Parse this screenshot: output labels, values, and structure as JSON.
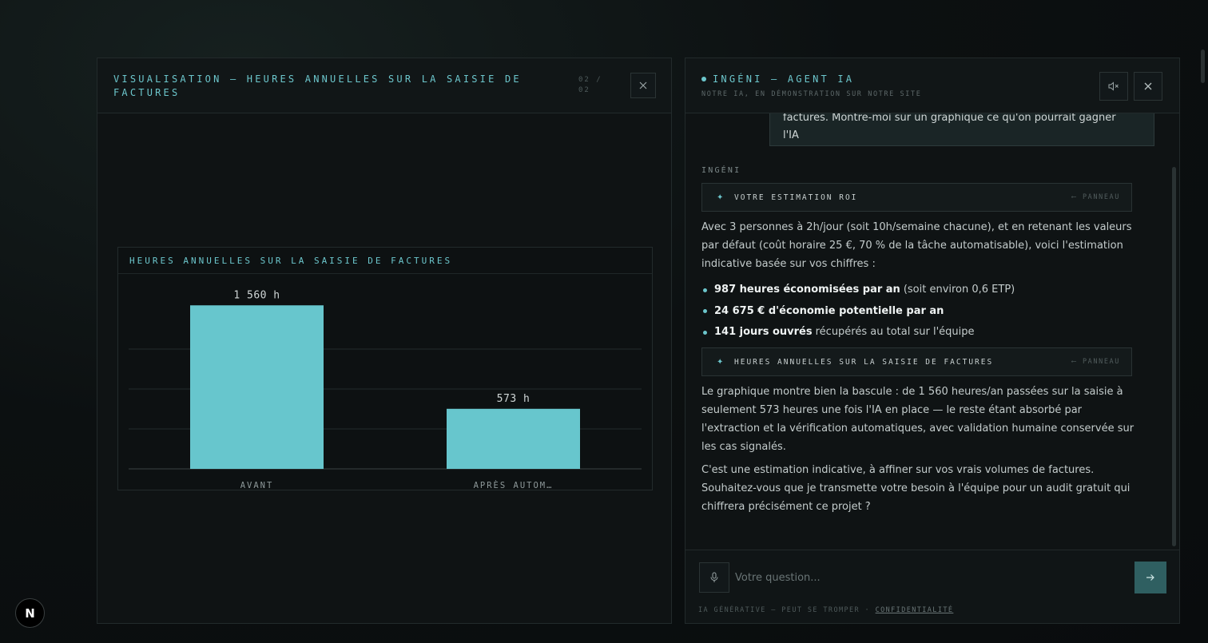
{
  "viz_panel": {
    "title": "VISUALISATION — HEURES ANNUELLES SUR LA SAISIE DE FACTURES",
    "page_indicator": "02 / 02",
    "close_icon": "close-icon"
  },
  "chart_data": {
    "type": "bar",
    "title": "HEURES ANNUELLES SUR LA SAISIE DE FACTURES",
    "categories": [
      "AVANT",
      "APRÈS AUTOM…"
    ],
    "values": [
      1560,
      573
    ],
    "value_labels": [
      "1 560 h",
      "573 h"
    ],
    "ylim": [
      0,
      1600
    ],
    "grid": true,
    "bar_color": "#67c6cd"
  },
  "chat": {
    "title": "INGÉNI — AGENT IA",
    "subtitle": "NOTRE IA, EN DÉMONSTRATION SUR NOTRE SITE",
    "user_message_partial": "factures. Montre-moi sur un graphique ce qu'on pourrait gagner avec",
    "user_message_end": "l'IA",
    "bot_label": "INGÉNI",
    "chip_roi": {
      "label": "VOTRE ESTIMATION ROI",
      "link": "⟵ PANNEAU"
    },
    "intro": "Avec 3 personnes à 2h/jour (soit 10h/semaine chacune), et en retenant les valeurs par défaut (coût horaire 25 €, 70 % de la tâche automatisable), voici l'estimation indicative basée sur vos chiffres :",
    "bullets": [
      {
        "bold": "987 heures économisées par an",
        "rest": "(soit environ 0,6 ETP)"
      },
      {
        "bold": "24 675 € d'économie potentielle par an",
        "rest": ""
      },
      {
        "bold": "141 jours ouvrés",
        "rest": "récupérés au total sur l'équipe"
      }
    ],
    "chip_chart": {
      "label": "HEURES ANNUELLES SUR LA SAISIE DE FACTURES",
      "link": "⟵ PANNEAU"
    },
    "chart_comment": "Le graphique montre bien la bascule : de 1 560 heures/an passées sur la saisie à seulement 573 heures une fois l'IA en place — le reste étant absorbé par l'extraction et la vérification automatiques, avec validation humaine conservée sur les cas signalés.",
    "closing": "C'est une estimation indicative, à affiner sur vos vrais volumes de factures. Souhaitez-vous que je transmette votre besoin à l'équipe pour un audit gratuit qui chiffrera précisément ce projet ?",
    "input_placeholder": "Votre question...",
    "disclaimer": "IA GÉNÉRATIVE — PEUT SE TROMPER ·",
    "privacy_link": "CONFIDENTIALITÉ"
  },
  "badge": {
    "letter": "N"
  },
  "colors": {
    "accent": "#6cc6cc",
    "bar": "#67c6cd",
    "send": "#2f5f61"
  }
}
